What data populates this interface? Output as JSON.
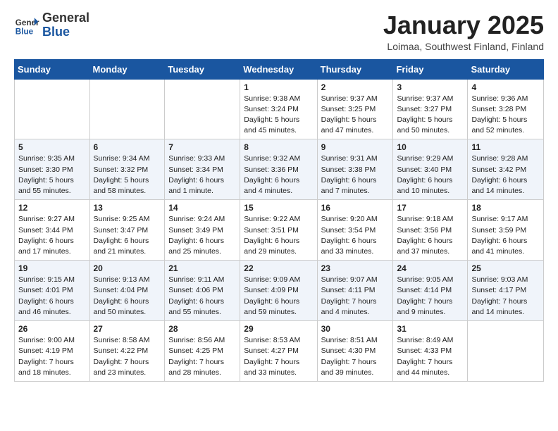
{
  "header": {
    "logo_general": "General",
    "logo_blue": "Blue",
    "title": "January 2025",
    "location": "Loimaa, Southwest Finland, Finland"
  },
  "days_of_week": [
    "Sunday",
    "Monday",
    "Tuesday",
    "Wednesday",
    "Thursday",
    "Friday",
    "Saturday"
  ],
  "weeks": [
    [
      {
        "day": "",
        "info": ""
      },
      {
        "day": "",
        "info": ""
      },
      {
        "day": "",
        "info": ""
      },
      {
        "day": "1",
        "info": "Sunrise: 9:38 AM\nSunset: 3:24 PM\nDaylight: 5 hours\nand 45 minutes."
      },
      {
        "day": "2",
        "info": "Sunrise: 9:37 AM\nSunset: 3:25 PM\nDaylight: 5 hours\nand 47 minutes."
      },
      {
        "day": "3",
        "info": "Sunrise: 9:37 AM\nSunset: 3:27 PM\nDaylight: 5 hours\nand 50 minutes."
      },
      {
        "day": "4",
        "info": "Sunrise: 9:36 AM\nSunset: 3:28 PM\nDaylight: 5 hours\nand 52 minutes."
      }
    ],
    [
      {
        "day": "5",
        "info": "Sunrise: 9:35 AM\nSunset: 3:30 PM\nDaylight: 5 hours\nand 55 minutes."
      },
      {
        "day": "6",
        "info": "Sunrise: 9:34 AM\nSunset: 3:32 PM\nDaylight: 5 hours\nand 58 minutes."
      },
      {
        "day": "7",
        "info": "Sunrise: 9:33 AM\nSunset: 3:34 PM\nDaylight: 6 hours\nand 1 minute."
      },
      {
        "day": "8",
        "info": "Sunrise: 9:32 AM\nSunset: 3:36 PM\nDaylight: 6 hours\nand 4 minutes."
      },
      {
        "day": "9",
        "info": "Sunrise: 9:31 AM\nSunset: 3:38 PM\nDaylight: 6 hours\nand 7 minutes."
      },
      {
        "day": "10",
        "info": "Sunrise: 9:29 AM\nSunset: 3:40 PM\nDaylight: 6 hours\nand 10 minutes."
      },
      {
        "day": "11",
        "info": "Sunrise: 9:28 AM\nSunset: 3:42 PM\nDaylight: 6 hours\nand 14 minutes."
      }
    ],
    [
      {
        "day": "12",
        "info": "Sunrise: 9:27 AM\nSunset: 3:44 PM\nDaylight: 6 hours\nand 17 minutes."
      },
      {
        "day": "13",
        "info": "Sunrise: 9:25 AM\nSunset: 3:47 PM\nDaylight: 6 hours\nand 21 minutes."
      },
      {
        "day": "14",
        "info": "Sunrise: 9:24 AM\nSunset: 3:49 PM\nDaylight: 6 hours\nand 25 minutes."
      },
      {
        "day": "15",
        "info": "Sunrise: 9:22 AM\nSunset: 3:51 PM\nDaylight: 6 hours\nand 29 minutes."
      },
      {
        "day": "16",
        "info": "Sunrise: 9:20 AM\nSunset: 3:54 PM\nDaylight: 6 hours\nand 33 minutes."
      },
      {
        "day": "17",
        "info": "Sunrise: 9:18 AM\nSunset: 3:56 PM\nDaylight: 6 hours\nand 37 minutes."
      },
      {
        "day": "18",
        "info": "Sunrise: 9:17 AM\nSunset: 3:59 PM\nDaylight: 6 hours\nand 41 minutes."
      }
    ],
    [
      {
        "day": "19",
        "info": "Sunrise: 9:15 AM\nSunset: 4:01 PM\nDaylight: 6 hours\nand 46 minutes."
      },
      {
        "day": "20",
        "info": "Sunrise: 9:13 AM\nSunset: 4:04 PM\nDaylight: 6 hours\nand 50 minutes."
      },
      {
        "day": "21",
        "info": "Sunrise: 9:11 AM\nSunset: 4:06 PM\nDaylight: 6 hours\nand 55 minutes."
      },
      {
        "day": "22",
        "info": "Sunrise: 9:09 AM\nSunset: 4:09 PM\nDaylight: 6 hours\nand 59 minutes."
      },
      {
        "day": "23",
        "info": "Sunrise: 9:07 AM\nSunset: 4:11 PM\nDaylight: 7 hours\nand 4 minutes."
      },
      {
        "day": "24",
        "info": "Sunrise: 9:05 AM\nSunset: 4:14 PM\nDaylight: 7 hours\nand 9 minutes."
      },
      {
        "day": "25",
        "info": "Sunrise: 9:03 AM\nSunset: 4:17 PM\nDaylight: 7 hours\nand 14 minutes."
      }
    ],
    [
      {
        "day": "26",
        "info": "Sunrise: 9:00 AM\nSunset: 4:19 PM\nDaylight: 7 hours\nand 18 minutes."
      },
      {
        "day": "27",
        "info": "Sunrise: 8:58 AM\nSunset: 4:22 PM\nDaylight: 7 hours\nand 23 minutes."
      },
      {
        "day": "28",
        "info": "Sunrise: 8:56 AM\nSunset: 4:25 PM\nDaylight: 7 hours\nand 28 minutes."
      },
      {
        "day": "29",
        "info": "Sunrise: 8:53 AM\nSunset: 4:27 PM\nDaylight: 7 hours\nand 33 minutes."
      },
      {
        "day": "30",
        "info": "Sunrise: 8:51 AM\nSunset: 4:30 PM\nDaylight: 7 hours\nand 39 minutes."
      },
      {
        "day": "31",
        "info": "Sunrise: 8:49 AM\nSunset: 4:33 PM\nDaylight: 7 hours\nand 44 minutes."
      },
      {
        "day": "",
        "info": ""
      }
    ]
  ]
}
